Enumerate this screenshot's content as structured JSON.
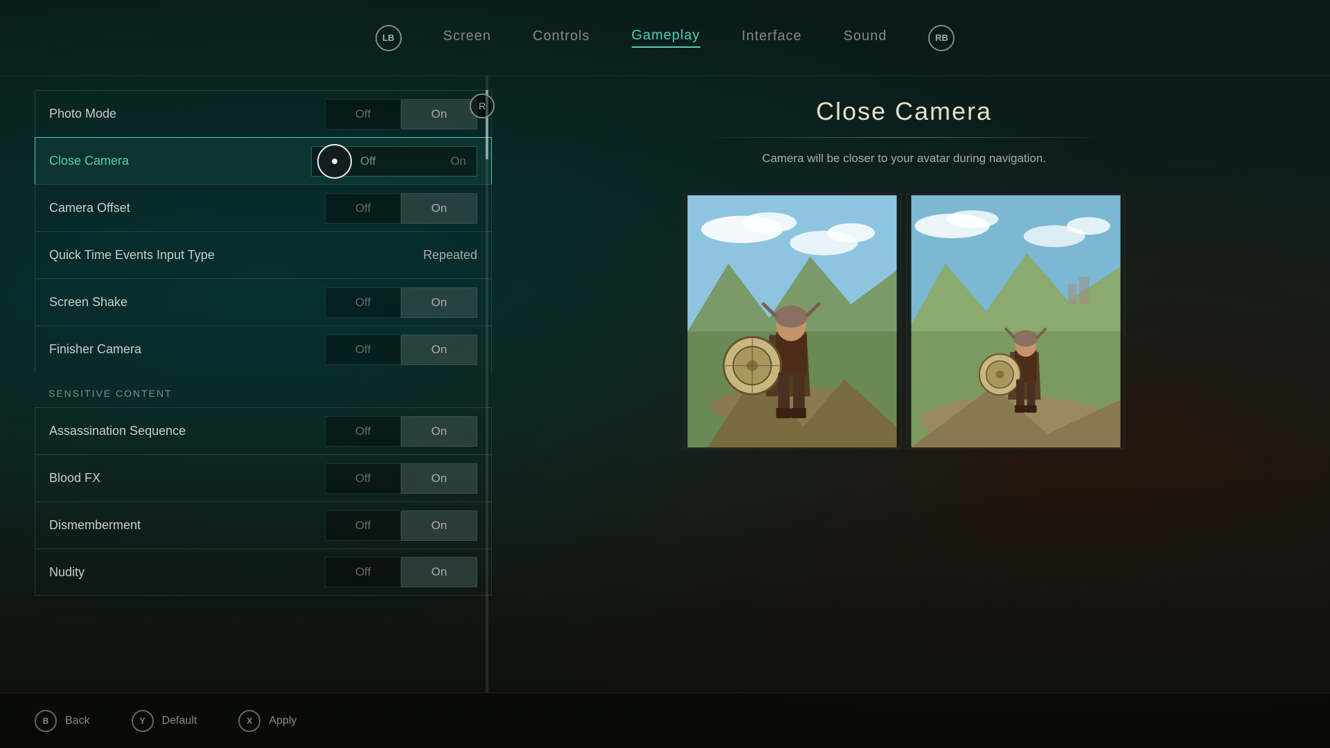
{
  "nav": {
    "left_btn": "LB",
    "right_btn": "RB",
    "tabs": [
      {
        "label": "Screen",
        "active": false
      },
      {
        "label": "Controls",
        "active": false
      },
      {
        "label": "Gameplay",
        "active": true
      },
      {
        "label": "Interface",
        "active": false
      },
      {
        "label": "Sound",
        "active": false
      }
    ]
  },
  "settings": {
    "rows": [
      {
        "label": "Photo Mode",
        "control": "toggle",
        "value_off": "Off",
        "value_on": "On",
        "selected": "on",
        "active": false
      },
      {
        "label": "Close Camera",
        "control": "slider",
        "value_off": "Off",
        "value_on": "On",
        "selected": "off",
        "active": true
      },
      {
        "label": "Camera Offset",
        "control": "toggle",
        "value_off": "Off",
        "value_on": "On",
        "selected": "on",
        "active": false
      },
      {
        "label": "Quick Time Events Input Type",
        "control": "value",
        "value": "Repeated",
        "active": false
      },
      {
        "label": "Screen Shake",
        "control": "toggle",
        "value_off": "Off",
        "value_on": "On",
        "selected": "on",
        "active": false
      },
      {
        "label": "Finisher Camera",
        "control": "toggle",
        "value_off": "Off",
        "value_on": "On",
        "selected": "on",
        "active": false
      }
    ],
    "section_sensitive": "SENSITIVE CONTENT",
    "sensitive_rows": [
      {
        "label": "Assassination Sequence",
        "control": "toggle",
        "value_off": "Off",
        "value_on": "On",
        "selected": "on",
        "active": false
      },
      {
        "label": "Blood FX",
        "control": "toggle",
        "value_off": "Off",
        "value_on": "On",
        "selected": "on",
        "active": false
      },
      {
        "label": "Dismemberment",
        "control": "toggle",
        "value_off": "Off",
        "value_on": "On",
        "selected": "on",
        "active": false
      },
      {
        "label": "Nudity",
        "control": "toggle",
        "value_off": "Off",
        "value_on": "On",
        "selected": "on",
        "active": false
      }
    ]
  },
  "detail": {
    "title": "Close Camera",
    "divider": true,
    "description": "Camera will be closer to your avatar during navigation."
  },
  "bottom": {
    "back_icon": "B",
    "back_label": "Back",
    "default_icon": "Y",
    "default_label": "Default",
    "apply_icon": "X",
    "apply_label": "Apply"
  },
  "r_icon": "R"
}
